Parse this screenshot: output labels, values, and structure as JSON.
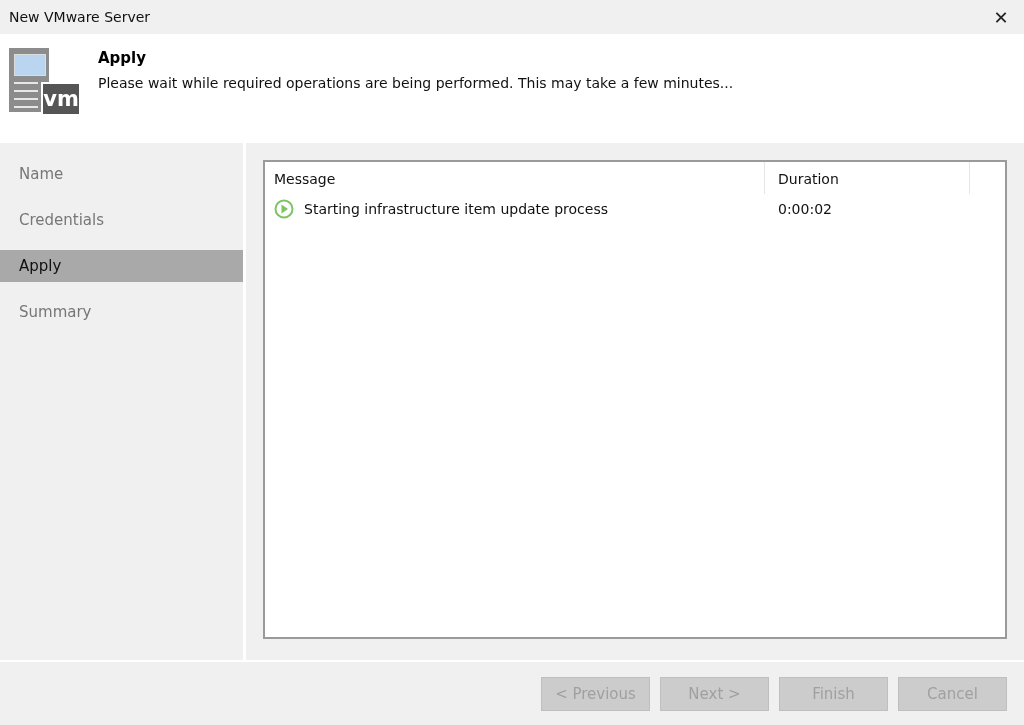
{
  "window": {
    "title": "New VMware Server",
    "close_glyph": "✕"
  },
  "header": {
    "title": "Apply",
    "description": "Please wait while required operations are being performed. This may take a few minutes...",
    "logo_text": "vm"
  },
  "sidebar": {
    "items": [
      {
        "label": "Name",
        "selected": false
      },
      {
        "label": "Credentials",
        "selected": false
      },
      {
        "label": "Apply",
        "selected": true
      },
      {
        "label": "Summary",
        "selected": false
      }
    ]
  },
  "table": {
    "columns": [
      "Message",
      "Duration"
    ],
    "rows": [
      {
        "kind": "running",
        "message": "Starting infrastructure item update process",
        "duration": "0:00:02"
      }
    ]
  },
  "buttons": [
    {
      "label": "< Previous",
      "disabled": true
    },
    {
      "label": "Next >",
      "disabled": true
    },
    {
      "label": "Finish",
      "disabled": true
    },
    {
      "label": "Cancel",
      "disabled": true
    }
  ]
}
